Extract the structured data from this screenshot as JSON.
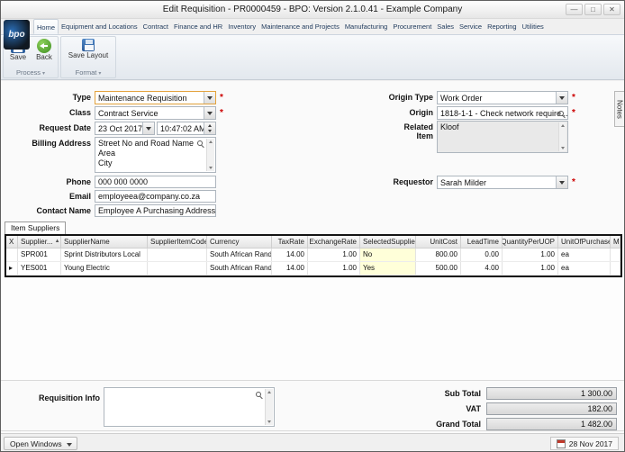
{
  "window": {
    "title": "Edit Requisition - PR0000459 - BPO: Version 2.1.0.41 - Example Company",
    "controls": [
      {
        "name": "minimize",
        "glyph": "—"
      },
      {
        "name": "maximize",
        "glyph": "□"
      },
      {
        "name": "close",
        "glyph": "✕"
      }
    ]
  },
  "ui": {
    "required_marker": "*"
  },
  "colors": {
    "required_red": "#cc0000",
    "highlight_yellow": "#ffffd9",
    "save_icon_blue": "#2d5d99",
    "back_icon_green": "#3f8f23"
  },
  "ribbon": {
    "logo": "bpo",
    "tabs": [
      {
        "label": "Home",
        "active": true
      },
      {
        "label": "Equipment and Locations"
      },
      {
        "label": "Contract"
      },
      {
        "label": "Finance and HR"
      },
      {
        "label": "Inventory"
      },
      {
        "label": "Maintenance and Projects"
      },
      {
        "label": "Manufacturing"
      },
      {
        "label": "Procurement"
      },
      {
        "label": "Sales"
      },
      {
        "label": "Service"
      },
      {
        "label": "Reporting"
      },
      {
        "label": "Utilities"
      }
    ],
    "buttons": [
      {
        "label": "Save"
      },
      {
        "label": "Back"
      },
      {
        "label": "Save Layout"
      }
    ],
    "groups": [
      {
        "label": "Process"
      },
      {
        "label": "Format"
      }
    ]
  },
  "form": {
    "type": {
      "label": "Type",
      "value": "Maintenance Requisition"
    },
    "class": {
      "label": "Class",
      "value": "Contract Service"
    },
    "request_date": {
      "label": "Request Date",
      "date": "23 Oct 2017",
      "time": "10:47:02 AM"
    },
    "billing_address": {
      "label": "Billing Address",
      "value": "Street No and Road Name\nArea\nCity"
    },
    "phone": {
      "label": "Phone",
      "value": "000 000 0000"
    },
    "email": {
      "label": "Email",
      "value": "employeea@company.co.za"
    },
    "contact_name": {
      "label": "Contact Name",
      "value": "Employee A Purchasing Address"
    },
    "origin_type": {
      "label": "Origin Type",
      "value": "Work Order"
    },
    "origin": {
      "label": "Origin",
      "value": "1818-1-1 - Check network require..."
    },
    "related_item": {
      "label": "Related Item",
      "value": "Kloof"
    },
    "requestor": {
      "label": "Requestor",
      "value": "Sarah Milder"
    },
    "notes_tab": "Notes"
  },
  "suppliers": {
    "tab_label": "Item Suppliers",
    "sort_glyph": "▲",
    "columns": [
      {
        "key": "indicator",
        "label": "X",
        "width": 13
      },
      {
        "key": "code",
        "label": "Supplier...",
        "width": 48,
        "sort": "asc"
      },
      {
        "key": "name",
        "label": "SupplierName",
        "width": 96
      },
      {
        "key": "item_code",
        "label": "SupplierItemCode",
        "width": 66
      },
      {
        "key": "currency",
        "label": "Currency",
        "width": 72
      },
      {
        "key": "tax",
        "label": "TaxRate",
        "width": 40,
        "align": "right"
      },
      {
        "key": "exchange",
        "label": "ExchangeRate",
        "width": 58,
        "align": "right"
      },
      {
        "key": "selected",
        "label": "SelectedSupplier",
        "width": 62,
        "highlight": true
      },
      {
        "key": "unit_cost",
        "label": "UnitCost",
        "width": 50,
        "align": "right"
      },
      {
        "key": "lead",
        "label": "LeadTime",
        "width": 46,
        "align": "right"
      },
      {
        "key": "qty",
        "label": "QuantityPerUOP",
        "width": 62,
        "align": "right"
      },
      {
        "key": "uop",
        "label": "UnitOfPurchase",
        "width": 58
      },
      {
        "key": "mi",
        "label": "Mi",
        "width": 11
      }
    ],
    "rows": [
      {
        "indicator": "",
        "code": "SPR001",
        "name": "Sprint Distributors Local",
        "item_code": "",
        "currency": "South African Rand",
        "tax": "14.00",
        "exchange": "1.00",
        "selected": "No",
        "unit_cost": "800.00",
        "lead": "0.00",
        "qty": "1.00",
        "uop": "ea",
        "mi": ""
      },
      {
        "indicator": "▸",
        "code": "YES001",
        "name": "Young Electric",
        "item_code": "",
        "currency": "South African Rand",
        "tax": "14.00",
        "exchange": "1.00",
        "selected": "Yes",
        "unit_cost": "500.00",
        "lead": "4.00",
        "qty": "1.00",
        "uop": "ea",
        "mi": ""
      }
    ]
  },
  "footer": {
    "requisition_info": {
      "label": "Requisition Info",
      "value": ""
    },
    "totals": [
      {
        "label": "Sub Total",
        "value": "1 300.00"
      },
      {
        "label": "VAT",
        "value": "182.00"
      },
      {
        "label": "Grand Total",
        "value": "1 482.00"
      }
    ]
  },
  "statusbar": {
    "open_windows_label": "Open Windows",
    "date": "28 Nov 2017"
  }
}
